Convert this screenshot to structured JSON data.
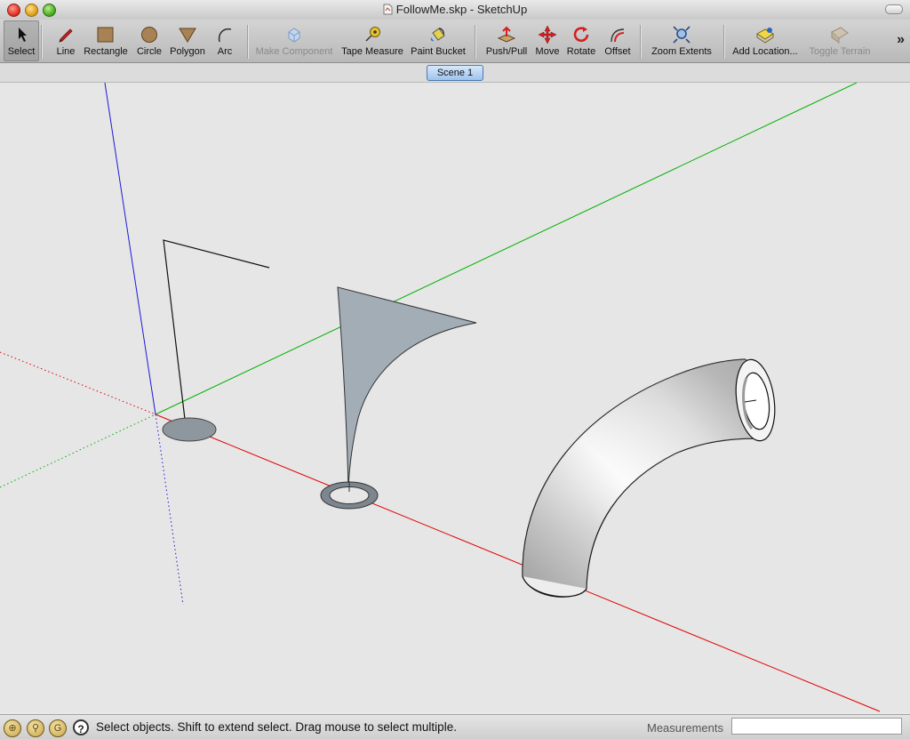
{
  "window": {
    "title": "FollowMe.skp - SketchUp"
  },
  "toolbar": {
    "tools": [
      {
        "label": "Select",
        "icon": "select-arrow-icon",
        "active": true,
        "enabled": true
      },
      {
        "label": "Line",
        "icon": "pencil-icon",
        "enabled": true
      },
      {
        "label": "Rectangle",
        "icon": "rectangle-icon",
        "enabled": true
      },
      {
        "label": "Circle",
        "icon": "circle-icon",
        "enabled": true
      },
      {
        "label": "Polygon",
        "icon": "polygon-icon",
        "enabled": true
      },
      {
        "label": "Arc",
        "icon": "arc-icon",
        "enabled": true
      },
      {
        "label": "Make Component",
        "icon": "component-icon",
        "enabled": false
      },
      {
        "label": "Tape Measure",
        "icon": "tape-measure-icon",
        "enabled": true
      },
      {
        "label": "Paint Bucket",
        "icon": "paint-bucket-icon",
        "enabled": true
      },
      {
        "label": "Push/Pull",
        "icon": "push-pull-icon",
        "enabled": true
      },
      {
        "label": "Move",
        "icon": "move-icon",
        "enabled": true
      },
      {
        "label": "Rotate",
        "icon": "rotate-icon",
        "enabled": true
      },
      {
        "label": "Offset",
        "icon": "offset-icon",
        "enabled": true
      },
      {
        "label": "Zoom Extents",
        "icon": "zoom-extents-icon",
        "enabled": true
      },
      {
        "label": "Add Location...",
        "icon": "add-location-icon",
        "enabled": true
      },
      {
        "label": "Toggle Terrain",
        "icon": "toggle-terrain-icon",
        "enabled": false
      }
    ],
    "overflow": "»"
  },
  "scenes": {
    "active_tab": "Scene 1"
  },
  "colors": {
    "axis_red": "#e00000",
    "axis_green": "#00b000",
    "axis_blue": "#1a1ad8",
    "face_gray": "#a3adb5",
    "viewport_bg": "#e6e6e6"
  },
  "status": {
    "message": "Select objects. Shift to extend select. Drag mouse to select multiple.",
    "measurements_label": "Measurements",
    "measurements_value": ""
  }
}
